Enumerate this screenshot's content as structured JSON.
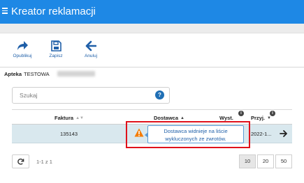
{
  "app": {
    "title": "Kreator reklamacji"
  },
  "toolbar": {
    "buttons": [
      {
        "label": "Opublikuj",
        "icon": "share-arrow-icon"
      },
      {
        "label": "Zapisz",
        "icon": "save-disk-icon"
      },
      {
        "label": "Anuluj",
        "icon": "arrow-left-icon"
      }
    ]
  },
  "pharmacy": {
    "prefix": "Apteka",
    "name": "TESTOWA"
  },
  "search": {
    "placeholder": "Szukaj",
    "help": "?"
  },
  "table": {
    "columns": [
      {
        "label": "Faktura"
      },
      {
        "label": "Dostawca"
      },
      {
        "label": "Wyst."
      },
      {
        "label": "Przyj."
      }
    ],
    "rows": [
      {
        "faktura": "135143",
        "przyj": "2022-1..."
      }
    ]
  },
  "tooltip": {
    "line1": "Dostawca widnieje na liście",
    "line2": "wykluczonych ze zwrotów."
  },
  "pagination": {
    "info": "1-1 z 1",
    "page_sizes": [
      "10",
      "20",
      "50"
    ],
    "selected": "10"
  },
  "colors": {
    "header": "#1e88e5",
    "accent": "#1f5fa8",
    "row_selected": "#d9e8ee",
    "highlight": "#e0121b",
    "warning": "#f57c00"
  }
}
